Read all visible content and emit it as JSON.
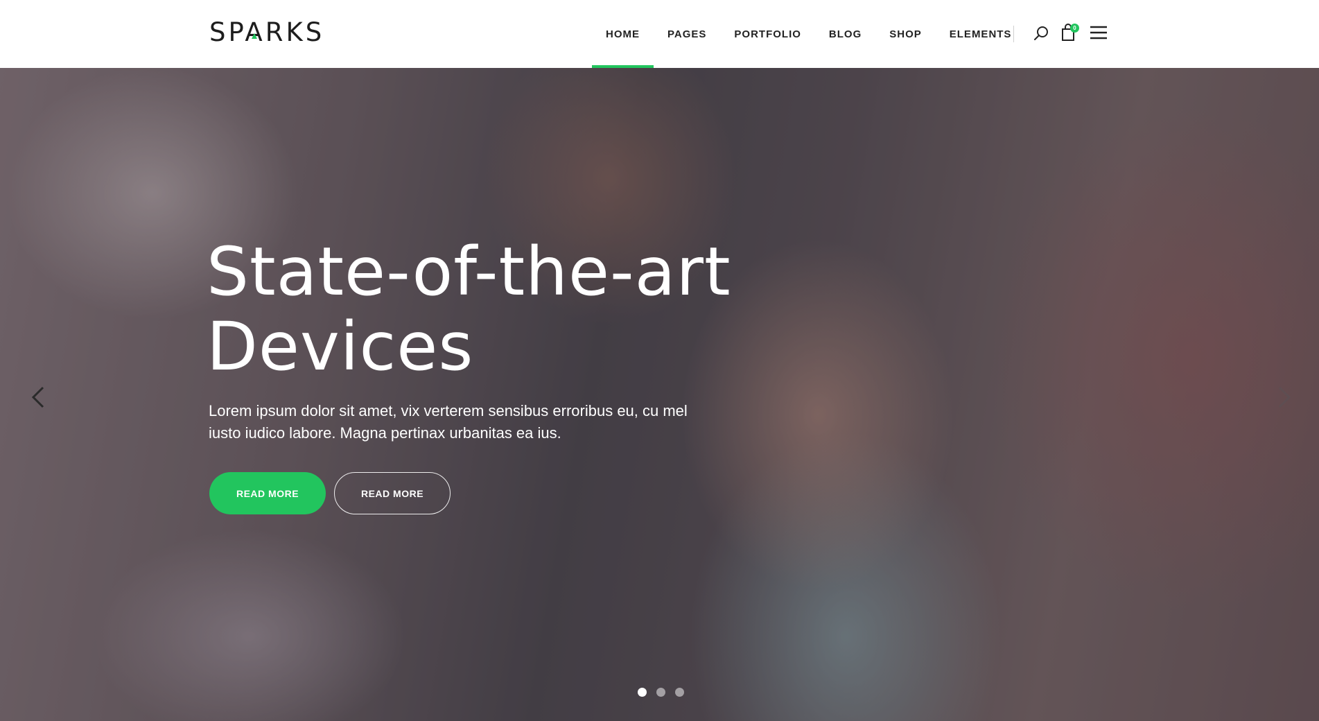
{
  "brand": {
    "name": "SPARKS",
    "accent_color": "#22c55e"
  },
  "nav": {
    "items": [
      {
        "label": "HOME",
        "active": true
      },
      {
        "label": "PAGES"
      },
      {
        "label": "PORTFOLIO"
      },
      {
        "label": "BLOG"
      },
      {
        "label": "SHOP"
      },
      {
        "label": "ELEMENTS"
      }
    ],
    "search_icon": "search-icon",
    "cart_icon": "shopping-bag-icon",
    "cart_count": "0",
    "menu_icon": "hamburger-menu-icon"
  },
  "hero": {
    "title_line1": "State-of-the-art",
    "title_line2": "Devices",
    "text": "Lorem ipsum dolor sit amet, vix verterem sensibus erroribus eu, cu mel iusto iudico labore. Magna pertinax urbanitas ea ius.",
    "primary_button": "READ MORE",
    "secondary_button": "READ MORE",
    "slide_count": 3,
    "active_slide": 1
  }
}
